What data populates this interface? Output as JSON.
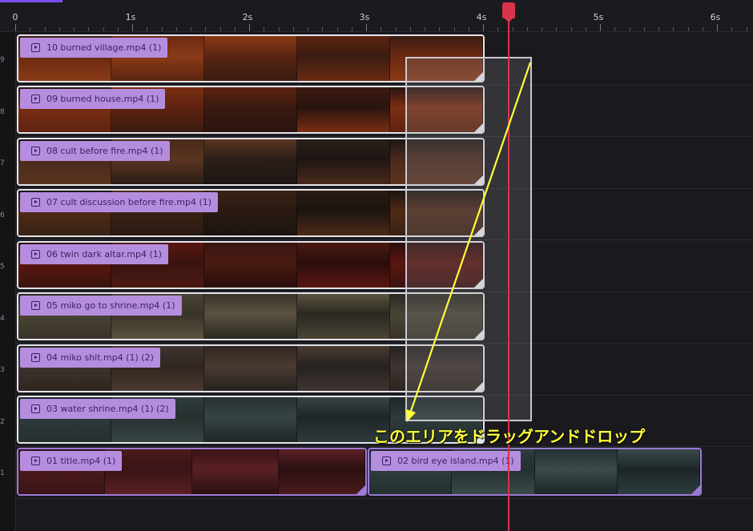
{
  "ruler": {
    "ticks": [
      "0",
      "1s",
      "2s",
      "3s",
      "4s",
      "5s",
      "6s"
    ]
  },
  "track_numbers": [
    "9",
    "8",
    "7",
    "6",
    "5",
    "4",
    "3",
    "2",
    "1"
  ],
  "clips": [
    {
      "name": "10 burned village.mp4 (1)",
      "palette": [
        "#3a1c12",
        "#6a2a12",
        "#8a3a16",
        "#5a2410"
      ]
    },
    {
      "name": "09 burned house.mp4 (1)",
      "palette": [
        "#2a140e",
        "#7a2e12",
        "#5e2210",
        "#3a1a10"
      ]
    },
    {
      "name": "08 cult before fire.mp4 (1)",
      "palette": [
        "#1e1614",
        "#4a2a1c",
        "#5a3420",
        "#2a1e18"
      ]
    },
    {
      "name": "07 cult discussion before fire.mp4 (1)",
      "palette": [
        "#1c1410",
        "#4e2a16",
        "#3a2214",
        "#2a1a12"
      ]
    },
    {
      "name": "06 twin dark altar.mp4 (1)",
      "palette": [
        "#2a0e0c",
        "#5a1610",
        "#3a1410",
        "#4a1a12"
      ]
    },
    {
      "name": "05 miko go to shrine.mp4 (1)",
      "palette": [
        "#2a2820",
        "#4a4436",
        "#3a3428",
        "#5a5240"
      ]
    },
    {
      "name": "04 miko shit.mp4 (1) (2)",
      "palette": [
        "#262220",
        "#3e3430",
        "#30261f",
        "#4a3a32"
      ]
    },
    {
      "name": "03 water shrine.mp4 (1) (2)",
      "palette": [
        "#1e2628",
        "#2e3a3c",
        "#26302f",
        "#384444"
      ]
    },
    {
      "name": "01 title.mp4 (1)",
      "palette": [
        "#2a1012",
        "#4a1a1c",
        "#3a1416",
        "#5a2024"
      ]
    },
    {
      "name": "02 bird eye island.mp4 (1)",
      "palette": [
        "#1c2628",
        "#2e3c3e",
        "#24302f",
        "#3a4a4a"
      ]
    }
  ],
  "annotation": {
    "text": "このエリアをドラッグアンドドロップ",
    "color": "#ffff3a"
  },
  "colors": {
    "playhead": "#d8344a",
    "clip_label_bg": "#b58ddf",
    "selected_border": "#9b7ad6"
  }
}
